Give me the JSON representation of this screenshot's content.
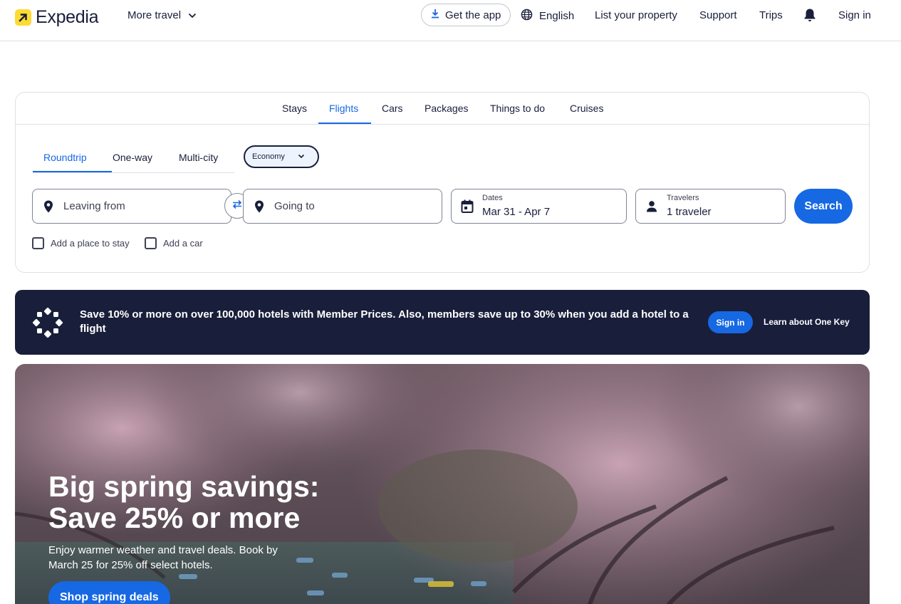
{
  "header": {
    "brand": "Expedia",
    "more_travel": "More travel",
    "get_app": "Get the app",
    "language": "English",
    "list_property": "List your property",
    "support": "Support",
    "trips": "Trips",
    "sign_in": "Sign in"
  },
  "search": {
    "lob_tabs": [
      "Stays",
      "Flights",
      "Cars",
      "Packages",
      "Things to do",
      "Cruises"
    ],
    "active_lob": "Flights",
    "trip_types": [
      "Roundtrip",
      "One-way",
      "Multi-city"
    ],
    "active_trip": "Roundtrip",
    "cabin_class": "Economy",
    "leaving_placeholder": "Leaving from",
    "going_placeholder": "Going to",
    "dates_label": "Dates",
    "dates_value": "Mar 31 - Apr 7",
    "travelers_label": "Travelers",
    "travelers_value": "1 traveler",
    "search_button": "Search",
    "add_stay": "Add a place to stay",
    "add_car": "Add a car"
  },
  "banner": {
    "text": "Save 10% or more on over 100,000 hotels with Member Prices. Also, members save up to 30% when you add a hotel to a flight",
    "sign_in": "Sign in",
    "learn": "Learn about One Key"
  },
  "hero": {
    "title": "Big spring savings: Save 25% or more",
    "subtitle": "Enjoy warmer weather and travel deals. Book by March 25 for 25% off select hotels.",
    "cta": "Shop spring deals"
  },
  "colors": {
    "brand_blue": "#1668e3",
    "navy": "#191e3b",
    "logo_yellow": "#fddb32"
  }
}
